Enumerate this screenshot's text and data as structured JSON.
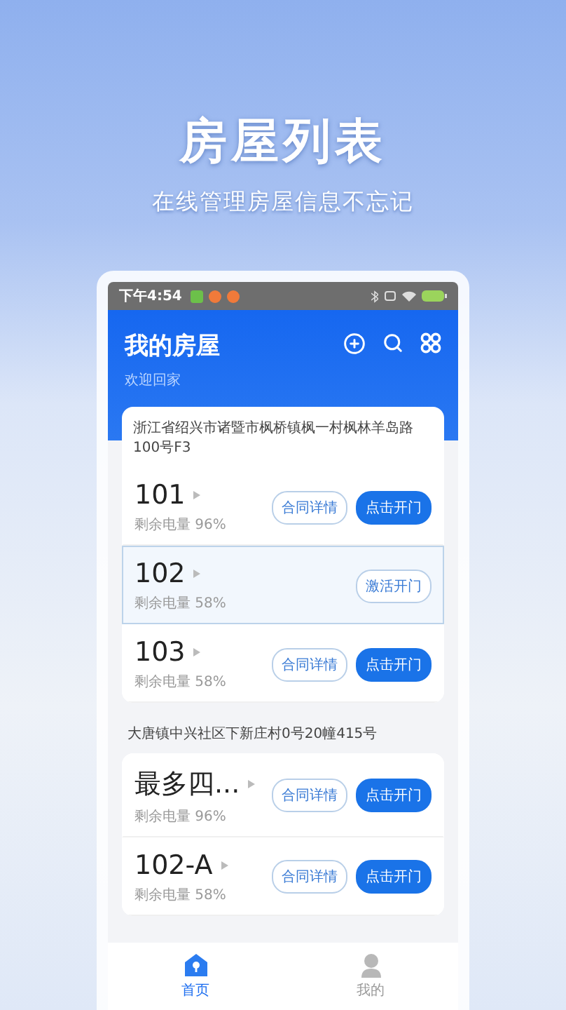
{
  "promo": {
    "title": "房屋列表",
    "subtitle": "在线管理房屋信息不忘记"
  },
  "status_bar": {
    "time": "下午4:54"
  },
  "header": {
    "title": "我的房屋",
    "subtitle": "欢迎回家"
  },
  "groups": [
    {
      "kind": "card",
      "address": "浙江省绍兴市诸暨市枫桥镇枫一村枫林羊岛路100号F3",
      "rooms": [
        {
          "name": "101",
          "battery": "剩余电量 96%",
          "selected": false,
          "buttons": [
            {
              "label": "合同详情",
              "kind": "outline"
            },
            {
              "label": "点击开门",
              "kind": "filled"
            }
          ]
        },
        {
          "name": "102",
          "battery": "剩余电量 58%",
          "selected": true,
          "buttons": [
            {
              "label": "激活开门",
              "kind": "outline"
            }
          ]
        },
        {
          "name": "103",
          "battery": "剩余电量 58%",
          "selected": false,
          "buttons": [
            {
              "label": "合同详情",
              "kind": "outline"
            },
            {
              "label": "点击开门",
              "kind": "filled"
            }
          ]
        }
      ]
    },
    {
      "kind": "section",
      "address": "大唐镇中兴社区下新庄村0号20幢415号",
      "rooms": [
        {
          "name": "最多四...",
          "battery": "剩余电量 96%",
          "selected": false,
          "buttons": [
            {
              "label": "合同详情",
              "kind": "outline"
            },
            {
              "label": "点击开门",
              "kind": "filled"
            }
          ]
        },
        {
          "name": "102-A",
          "battery": "剩余电量 58%",
          "selected": false,
          "buttons": [
            {
              "label": "合同详情",
              "kind": "outline"
            },
            {
              "label": "点击开门",
              "kind": "filled"
            }
          ]
        }
      ]
    }
  ],
  "tabs": [
    {
      "label": "首页",
      "selected": true
    },
    {
      "label": "我的",
      "selected": false
    }
  ]
}
